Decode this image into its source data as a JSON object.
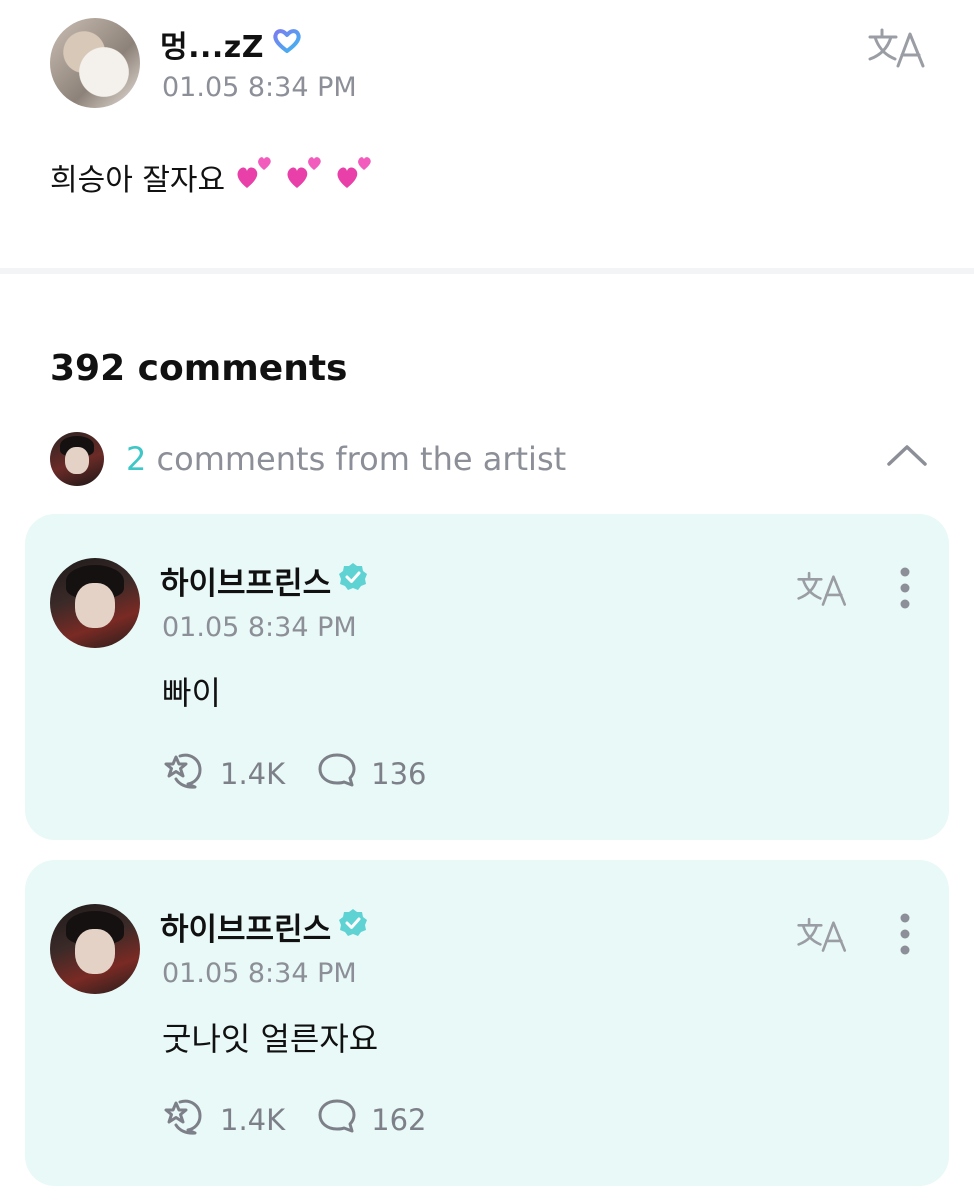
{
  "post": {
    "username": "멍...zZ",
    "timestamp": "01.05 8:34 PM",
    "body": "희승아 잘자요",
    "hearts": [
      "💕",
      "💕",
      "💕"
    ]
  },
  "comments_section": {
    "count_label": "392 comments",
    "artist_count": "2",
    "artist_label": "comments from the artist"
  },
  "comments": [
    {
      "username": "하이브프린스",
      "timestamp": "01.05 8:34 PM",
      "text": "빠이",
      "likes": "1.4K",
      "replies": "136"
    },
    {
      "username": "하이브프린스",
      "timestamp": "01.05 8:34 PM",
      "text": "굿나잇 얼른자요",
      "likes": "1.4K",
      "replies": "162"
    }
  ],
  "icons": {
    "translate": "translate-icon",
    "more": "more-vertical-icon",
    "verified": "verified-badge-icon",
    "fan-badge": "heart-badge-icon",
    "like": "like-icon",
    "reply": "comment-bubble-icon",
    "collapse": "chevron-up-icon"
  },
  "colors": {
    "accent": "#3fc7c7",
    "card_background": "#e8f9f7",
    "muted_text": "#8c8f97"
  }
}
